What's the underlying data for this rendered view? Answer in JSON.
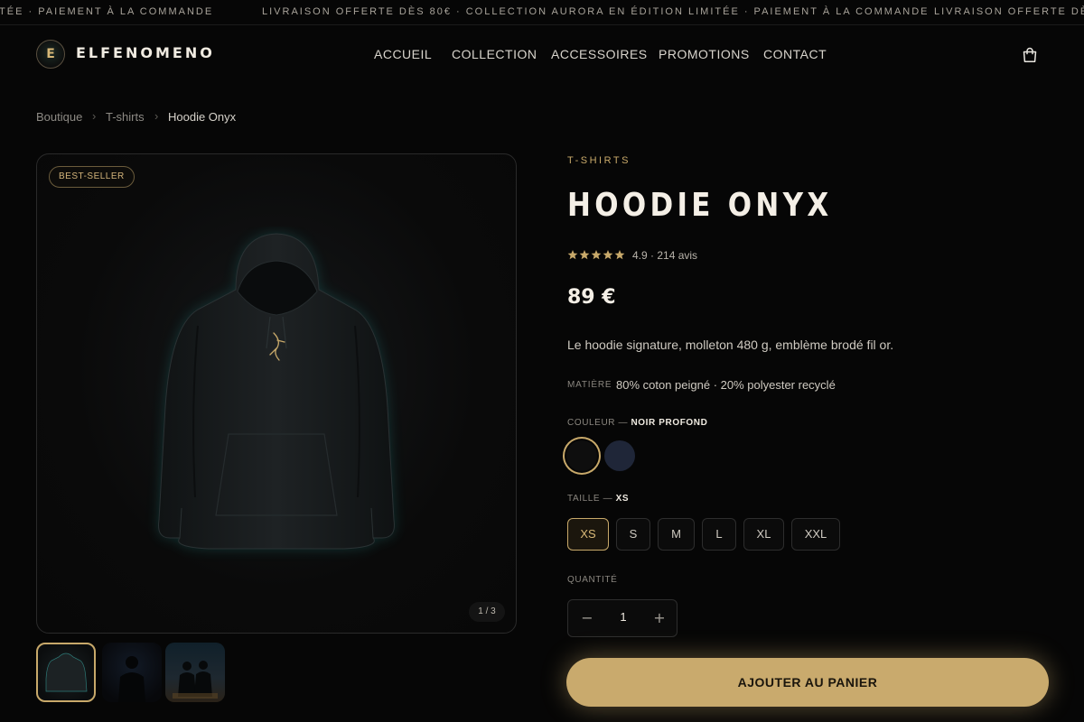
{
  "ticker": {
    "segments": [
      "ITÉE · PAIEMENT À LA COMMANDE",
      "LIVRAISON OFFERTE DÈS 80€ · COLLECTION AURORA EN ÉDITION LIMITÉE · PAIEMENT À LA COMMANDE",
      "LIVRAISON OFFERTE DÈ"
    ]
  },
  "header": {
    "logo_letter": "E",
    "brand": "ELFENOMENO",
    "nav": [
      "ACCUEIL",
      "COLLECTION",
      "ACCESSOIRES",
      "PROMOTIONS",
      "CONTACT"
    ],
    "cart_icon": "shopping-bag-icon"
  },
  "breadcrumb": [
    "Boutique",
    "T-shirts",
    "Hoodie Onyx"
  ],
  "gallery": {
    "badge": "BEST-SELLER",
    "counter": "1 / 3",
    "thumbnails": 3,
    "active_thumbnail": 1
  },
  "product": {
    "category": "T-SHIRTS",
    "title": "HOODIE ONYX",
    "rating": 4.9,
    "rating_text": "4.9 · 214 avis",
    "price": "89 €",
    "description": "Le hoodie signature, molleton 480 g, emblème brodé fil or.",
    "material_label": "MATIÈRE",
    "material_value": "80% coton peigné · 20% polyester recyclé"
  },
  "options": {
    "color_label": "COULEUR —",
    "color_value": "NOIR PROFOND",
    "colors": [
      {
        "hex": "#0e0e0e",
        "selected": true
      },
      {
        "hex": "#1f2638",
        "selected": false
      }
    ],
    "size_label": "TAILLE —",
    "size_value": "XS",
    "sizes": [
      "XS",
      "S",
      "M",
      "L",
      "XL",
      "XXL"
    ],
    "selected_size": "XS",
    "quantity_label": "QUANTITÉ",
    "quantity": "1",
    "minus": "−",
    "plus": "+"
  },
  "cta": {
    "add_to_cart": "AJOUTER AU PANIER"
  },
  "colors": {
    "accent": "#c8a96a",
    "background": "#060606"
  }
}
